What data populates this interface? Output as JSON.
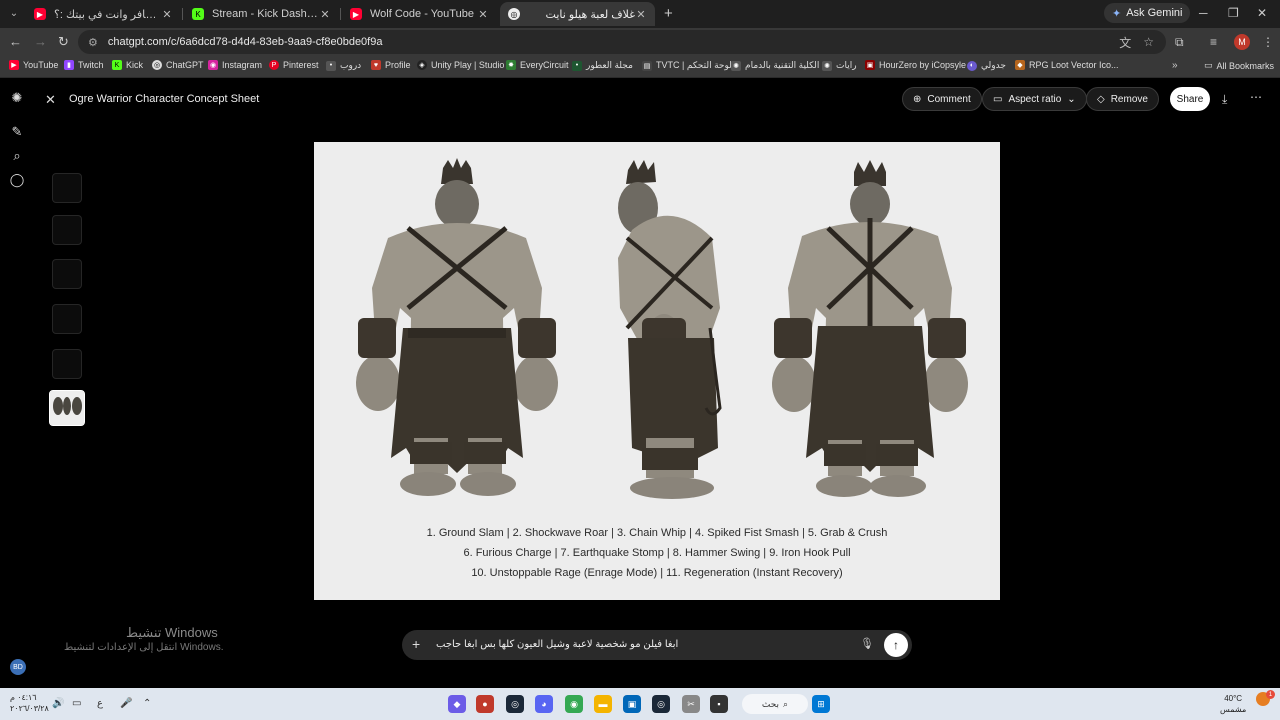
{
  "browser": {
    "tabs": [
      {
        "title": "كيف تسافر وانت في بيتك :؟ - be",
        "icon": "youtube-icon",
        "color": "#ff0033"
      },
      {
        "title": "Stream - Kick Dashboard",
        "icon": "kick-icon",
        "color": "#53fc18"
      },
      {
        "title": "Wolf Code - YouTube",
        "icon": "youtube-icon",
        "color": "#ff0033"
      },
      {
        "title": "غلاف لعبة هيلو نايت",
        "icon": "chatgpt-icon",
        "color": "#ffffff",
        "active": true
      }
    ],
    "ask_gemini": "Ask Gemini",
    "url": "chatgpt.com/c/6a6dcd78-d4d4-83eb-9aa9-cf8e0bde0f9a",
    "bookmarks": [
      "YouTube",
      "Twitch",
      "Kick",
      "ChatGPT",
      "Instagram",
      "Pinterest",
      "دروب",
      "Profile",
      "Unity Play | Studio",
      "EveryCircuit",
      "مجلة العطور",
      "TVTC | لوحة التحكم",
      "الكلية التقنية بالدمام",
      "رايات",
      "HourZero by iCopsyle",
      "جدولي",
      "RPG Loot Vector Ico..."
    ],
    "all_bookmarks": "All Bookmarks"
  },
  "viewer": {
    "title": "Ogre Warrior Character Concept Sheet",
    "comment": "Comment",
    "aspect_ratio": "Aspect ratio",
    "remove": "Remove",
    "share": "Share"
  },
  "image": {
    "moves_line1": "1. Ground Slam  |  2. Shockwave Roar  |  3. Chain Whip  |  4. Spiked Fist Smash  |  5. Grab & Crush",
    "moves_line2": "6. Furious Charge  |  7. Earthquake Stomp  |  8. Hammer Swing  |  9. Iron Hook Pull",
    "moves_line3": "10. Unstoppable Rage (Enrage Mode)  |  11. Regeneration (Instant Recovery)"
  },
  "composer": {
    "text": "ابغا فيلن مو شخصية لاعبة وشيل العيون كلها بس ابغا حاجب"
  },
  "watermark": {
    "line1": "تنشيط Windows",
    "line2": "انتقل إلى الإعدادات لتنشيط Windows."
  },
  "user": {
    "initials": "BD",
    "avatar_initial": "M"
  },
  "taskbar": {
    "search": "بحث",
    "weather_temp": "40°C",
    "weather_text": "مشمس",
    "time": "٠٤:١٦ م",
    "date": "٢٠٢٦/٠٣/٢٨",
    "lang": "ع"
  }
}
